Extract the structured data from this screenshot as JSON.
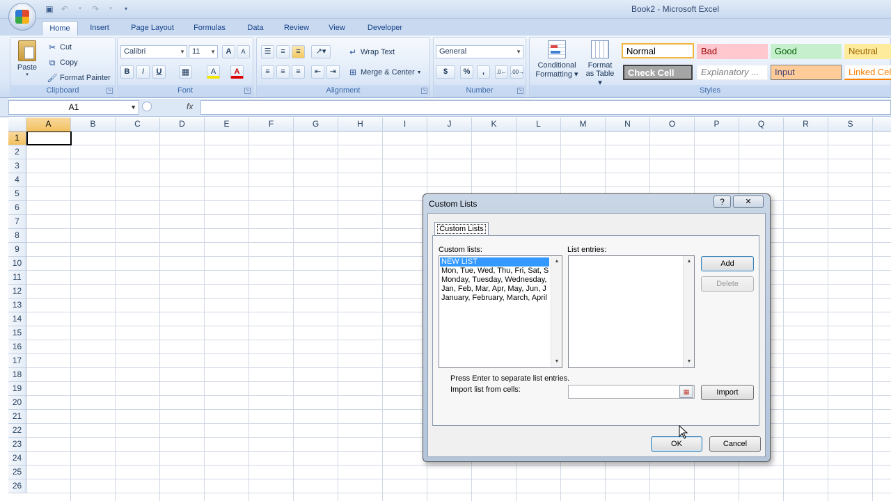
{
  "window": {
    "title": "Book2 - Microsoft Excel"
  },
  "qat": {
    "save_icon": "save-icon",
    "undo_icon": "undo-icon",
    "redo_icon": "redo-icon",
    "customize_icon": "chevron-down-icon"
  },
  "tabs": [
    {
      "label": "Home"
    },
    {
      "label": "Insert"
    },
    {
      "label": "Page Layout"
    },
    {
      "label": "Formulas"
    },
    {
      "label": "Data"
    },
    {
      "label": "Review"
    },
    {
      "label": "View"
    },
    {
      "label": "Developer"
    }
  ],
  "ribbon": {
    "clipboard": {
      "paste": "Paste",
      "cut": "Cut",
      "copy": "Copy",
      "format_painter": "Format Painter",
      "label": "Clipboard"
    },
    "font": {
      "name": "Calibri",
      "size": "11",
      "bold": "B",
      "italic": "I",
      "underline": "U",
      "grow": "A",
      "shrink": "A",
      "fill_color": "A",
      "font_color": "A",
      "label": "Font"
    },
    "alignment": {
      "wrap": "Wrap Text",
      "merge": "Merge & Center",
      "label": "Alignment"
    },
    "number": {
      "format": "General",
      "currency": "$",
      "percent": "%",
      "comma": ",",
      "label": "Number"
    },
    "styles": {
      "conditional_1": "Conditional",
      "conditional_2": "Formatting",
      "format_table_1": "Format",
      "format_table_2": "as Table",
      "normal": "Normal",
      "bad": "Bad",
      "good": "Good",
      "neutral": "Neutral",
      "check_cell": "Check Cell",
      "explanatory": "Explanatory ...",
      "input": "Input",
      "linked_cell": "Linked Cel",
      "label": "Styles"
    }
  },
  "formula_bar": {
    "name_box": "A1",
    "fx": "fx",
    "value": ""
  },
  "grid": {
    "columns": [
      "A",
      "B",
      "C",
      "D",
      "E",
      "F",
      "G",
      "H",
      "I",
      "J",
      "K",
      "L",
      "M",
      "N",
      "O",
      "P",
      "Q",
      "R",
      "S"
    ],
    "rows": [
      "1",
      "2",
      "3",
      "4",
      "5",
      "6",
      "7",
      "8",
      "9",
      "10",
      "11",
      "12",
      "13",
      "14",
      "15",
      "16",
      "17",
      "18",
      "19",
      "20",
      "21",
      "22",
      "23",
      "24",
      "25",
      "26"
    ]
  },
  "dialog": {
    "title": "Custom Lists",
    "help": "?",
    "close": "✕",
    "tab": "Custom Lists",
    "custom_lists_label": "Custom lists:",
    "list_entries_label": "List entries:",
    "custom_lists": [
      {
        "text": "NEW LIST"
      },
      {
        "text": "Mon, Tue, Wed, Thu, Fri, Sat, S"
      },
      {
        "text": "Monday, Tuesday, Wednesday,"
      },
      {
        "text": "Jan, Feb, Mar, Apr, May, Jun, J"
      },
      {
        "text": "January, February, March, April"
      }
    ],
    "add": "Add",
    "delete": "Delete",
    "hint": "Press Enter to separate list entries.",
    "import_label": "Import list from cells:",
    "import_value": "",
    "import": "Import",
    "ok": "OK",
    "cancel": "Cancel"
  }
}
